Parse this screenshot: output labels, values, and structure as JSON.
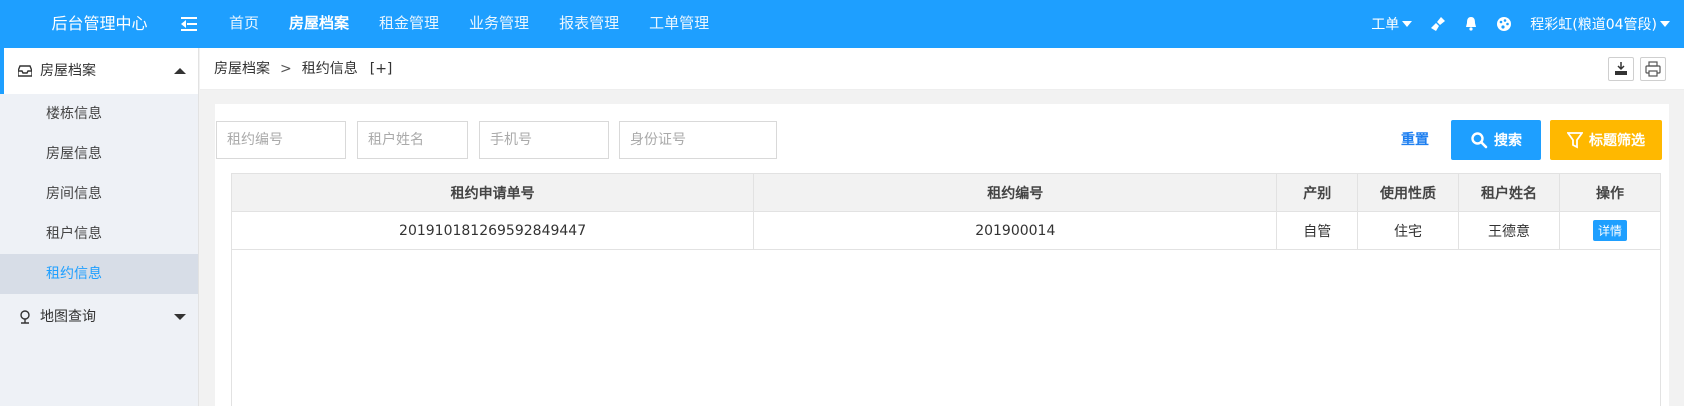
{
  "header": {
    "brand": "后台管理中心",
    "nav": [
      {
        "label": "首页"
      },
      {
        "label": "房屋档案"
      },
      {
        "label": "租金管理"
      },
      {
        "label": "业务管理"
      },
      {
        "label": "报表管理"
      },
      {
        "label": "工单管理"
      }
    ],
    "work_order_label": "工单",
    "user_name": "程彩虹(粮道04管段)",
    "icons": [
      "collapse-menu-icon",
      "clean-icon",
      "bell-icon",
      "palette-icon"
    ]
  },
  "sidebar": {
    "groups": [
      {
        "label": "房屋档案",
        "icon": "inbox-icon",
        "items": [
          {
            "label": "楼栋信息"
          },
          {
            "label": "房屋信息"
          },
          {
            "label": "房间信息"
          },
          {
            "label": "租户信息"
          },
          {
            "label": "租约信息"
          }
        ]
      },
      {
        "label": "地图查询",
        "icon": "map-pin-icon",
        "items": []
      }
    ]
  },
  "breadcrumb": {
    "items": [
      "房屋档案",
      "租约信息"
    ],
    "separator": ">",
    "plus": "[+]"
  },
  "filters": {
    "lease_no_placeholder": "租约编号",
    "tenant_name_placeholder": "租户姓名",
    "phone_placeholder": "手机号",
    "id_card_placeholder": "身份证号",
    "reset_label": "重置",
    "search_label": "搜索",
    "filter_label": "标题筛选"
  },
  "table": {
    "columns": [
      "租约申请单号",
      "租约编号",
      "产别",
      "使用性质",
      "租户姓名",
      "操作"
    ],
    "rows": [
      {
        "application_no": "201910181269592849447",
        "lease_no": "201900014",
        "property_type": "自管",
        "usage": "住宅",
        "tenant_name": "王德意",
        "action": "详情"
      }
    ]
  },
  "colors": {
    "primary": "#1e9fff",
    "warning": "#ffb800",
    "sidebar_bg": "#eef1f6",
    "sidebar_active_bg": "#d7dde7"
  }
}
